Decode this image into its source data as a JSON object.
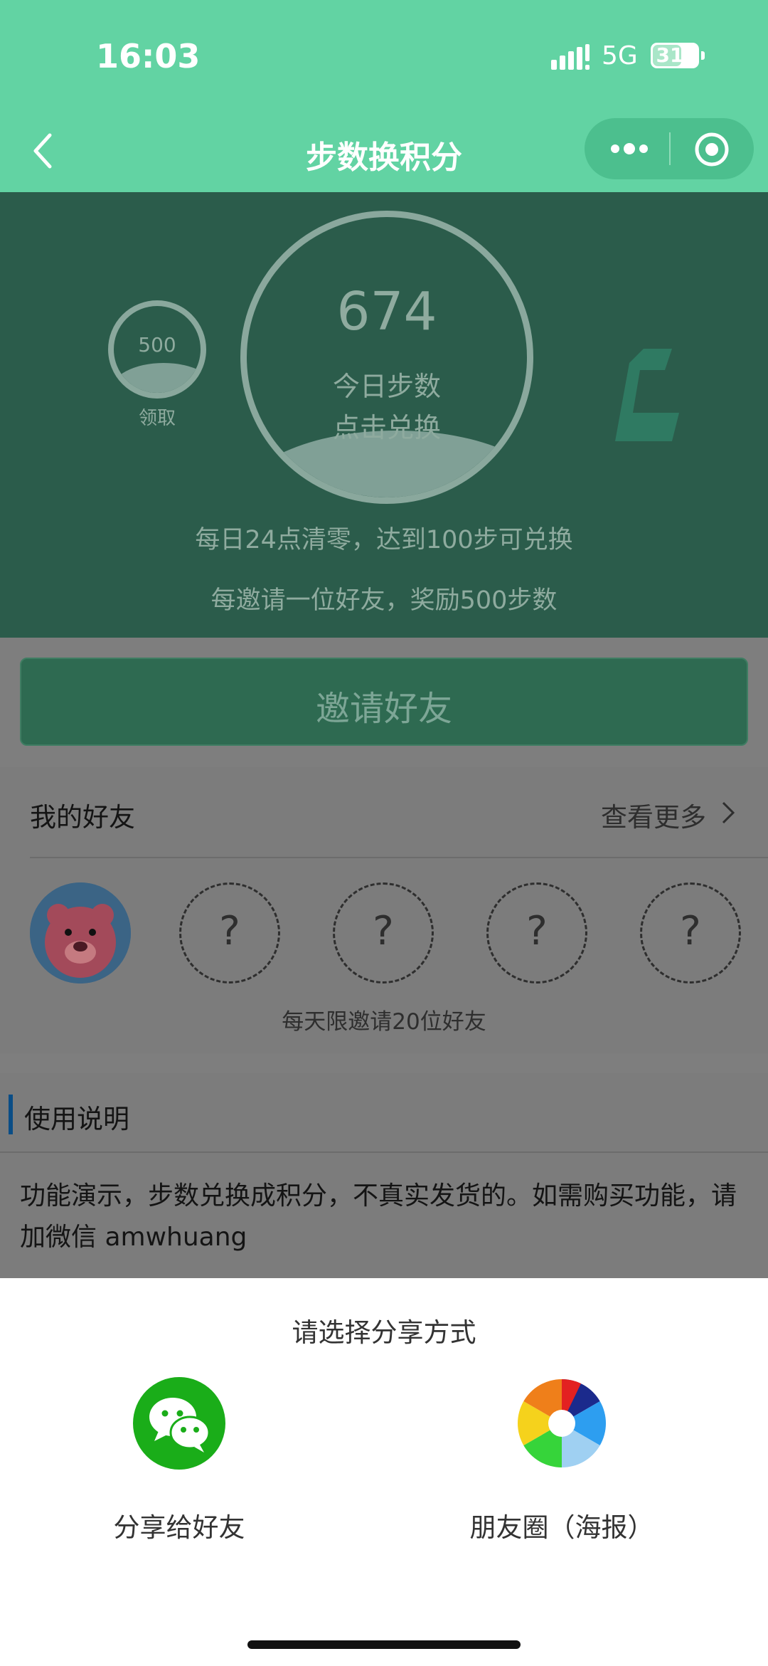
{
  "status_bar": {
    "time": "16:03",
    "network": "5G",
    "battery": "31"
  },
  "nav": {
    "title": "步数换积分"
  },
  "hero": {
    "steps": "674",
    "steps_label": "今日步数",
    "exchange_label": "点击兑换",
    "bubble_value": "500",
    "bubble_label": "领取",
    "line1": "每日24点清零，达到100步可兑换",
    "line2": "每邀请一位好友，奖励500步数"
  },
  "invite_button": "邀请好友",
  "friends": {
    "title": "我的好友",
    "more": "查看更多",
    "slots": [
      "?",
      "?",
      "?",
      "?"
    ],
    "limit_text": "每天限邀请20位好友"
  },
  "usage": {
    "title": "使用说明",
    "text": "功能演示，步数兑换成积分，不真实发货的。如需购买功能，请加微信 amwhuang"
  },
  "share_sheet": {
    "title": "请选择分享方式",
    "options": [
      {
        "label": "分享给好友",
        "icon": "wechat-icon"
      },
      {
        "label": "朋友圈（海报）",
        "icon": "moments-icon"
      }
    ]
  },
  "colors": {
    "header_green": "#62d3a3",
    "hero_dimmed": "#2b5c4b",
    "wechat_green": "#1aad19"
  }
}
